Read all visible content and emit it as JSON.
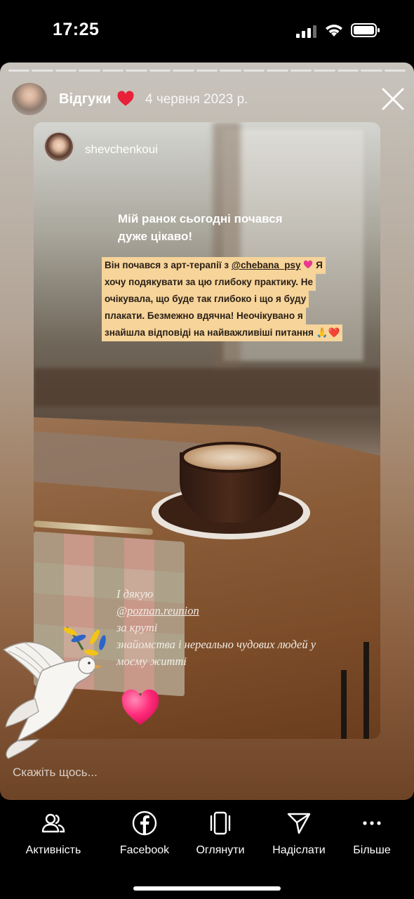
{
  "status": {
    "time": "17:25",
    "icons": [
      "cellular-signal-icon",
      "wifi-icon",
      "battery-icon"
    ]
  },
  "story": {
    "highlight_title": "Відгуки",
    "title_emoji": "red-heart-icon",
    "date": "4 червня 2023 р.",
    "progress_segments": 17,
    "close_icon": "close-icon"
  },
  "repost": {
    "username": "shevchenkoui",
    "caption_title_lines": [
      "Мій ранок сьогодні почався",
      "дуже цікаво!"
    ],
    "caption_body": {
      "line1_before": "Він почався з арт-терапії з ",
      "line1_mention": "@chebana_psy",
      "line1_after": " Я",
      "line2": "хочу подякувати за цю глибоку практику. Не",
      "line3": "очікувала, що буде так глибоко і що я буду",
      "line4": "плакати. Безмежно вдячна! Неочікувано я",
      "line5": "знайшла відповіді на найважливіші питання 🙏❤️"
    },
    "italic_caption": {
      "line1_before": "І дякую ",
      "line1_mention": "@poznan.reunion",
      "line1_after": " за круті",
      "line2": "знайомства і нереально чудових людей у",
      "line3": "моєму житті"
    }
  },
  "stickers": [
    "dove-sticker",
    "pink-heart-sticker"
  ],
  "reply": {
    "placeholder": "Скажіть щось..."
  },
  "actions": [
    {
      "label": "Активність",
      "icon": "activity-people-icon"
    },
    {
      "label": "Facebook",
      "icon": "facebook-icon"
    },
    {
      "label": "Оглянути",
      "icon": "mention-preview-icon"
    },
    {
      "label": "Надіслати",
      "icon": "send-paper-plane-icon"
    },
    {
      "label": "Більше",
      "icon": "more-dots-icon"
    }
  ],
  "colors": {
    "background": "#000000",
    "caption_highlight": "#f6d49a",
    "heart": "#e8203a",
    "pink_heart": "#ff3d8a"
  }
}
